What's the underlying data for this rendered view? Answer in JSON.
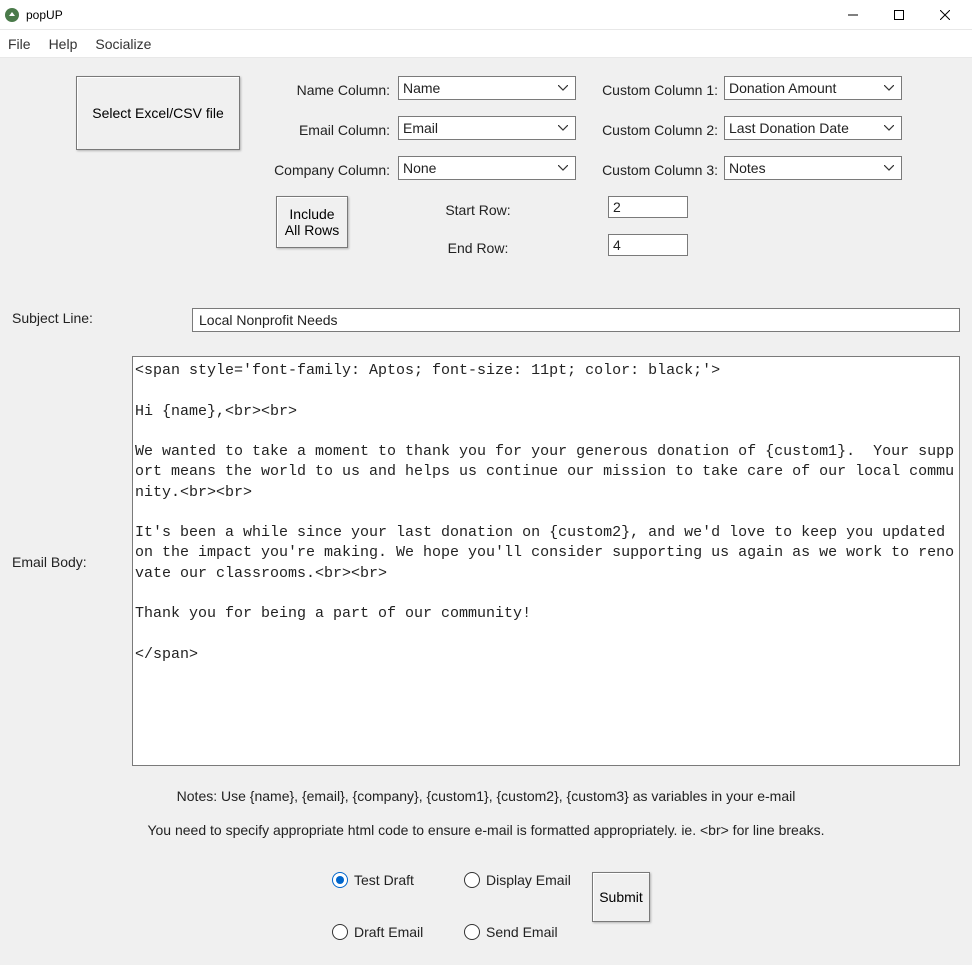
{
  "window": {
    "title": "popUP"
  },
  "menu": {
    "file": "File",
    "help": "Help",
    "socialize": "Socialize"
  },
  "buttons": {
    "select_file": "Select Excel/CSV file",
    "include_all_rows": "Include\nAll Rows",
    "submit": "Submit"
  },
  "labels": {
    "name_col": "Name Column:",
    "email_col": "Email Column:",
    "company_col": "Company Column:",
    "custom1": "Custom Column 1:",
    "custom2": "Custom Column 2:",
    "custom3": "Custom Column 3:",
    "start_row": "Start Row:",
    "end_row": "End Row:",
    "subject": "Subject Line:",
    "body": "Email Body:"
  },
  "columns": {
    "name": "Name",
    "email": "Email",
    "company": "None",
    "custom1": "Donation Amount",
    "custom2": "Last Donation Date",
    "custom3": "Notes"
  },
  "rows": {
    "start": "2",
    "end": "4"
  },
  "subject": "Local Nonprofit Needs",
  "email_body": "<span style='font-family: Aptos; font-size: 11pt; color: black;'>\n\nHi {name},<br><br>\n\nWe wanted to take a moment to thank you for your generous donation of {custom1}.  Your support means the world to us and helps us continue our mission to take care of our local community.<br><br>\n\nIt's been a while since your last donation on {custom2}, and we'd love to keep you updated on the impact you're making. We hope you'll consider supporting us again as we work to renovate our classrooms.<br><br>\n\nThank you for being a part of our community!\n\n</span>",
  "notes": {
    "line1": "Notes: Use {name}, {email}, {company}, {custom1}, {custom2}, {custom3} as variables in your e-mail",
    "line2": "You need to specify appropriate html code to ensure e-mail is formatted appropriately. ie. <br> for line breaks."
  },
  "radios": {
    "test_draft": "Test Draft",
    "display_email": "Display Email",
    "draft_email": "Draft Email",
    "send_email": "Send Email",
    "selected": "test_draft"
  }
}
